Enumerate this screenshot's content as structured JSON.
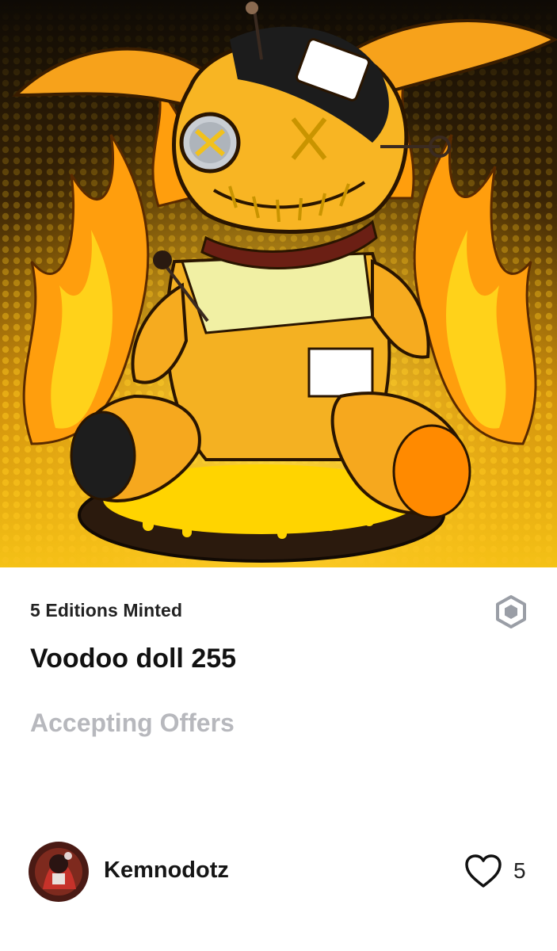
{
  "nft": {
    "editions_label": "5 Editions Minted",
    "title": "Voodoo doll 255",
    "status": "Accepting Offers"
  },
  "creator": {
    "name": "Kemnodotz"
  },
  "likes": {
    "count": "5"
  },
  "icons": {
    "chain": "hexagon-chain-icon",
    "like": "heart-outline-icon"
  },
  "colors": {
    "accent_orange": "#f5a623",
    "accent_yellow": "#ffd21a",
    "status_gray": "#b7b8bd",
    "chain_icon_gray": "#9a9ea6"
  }
}
